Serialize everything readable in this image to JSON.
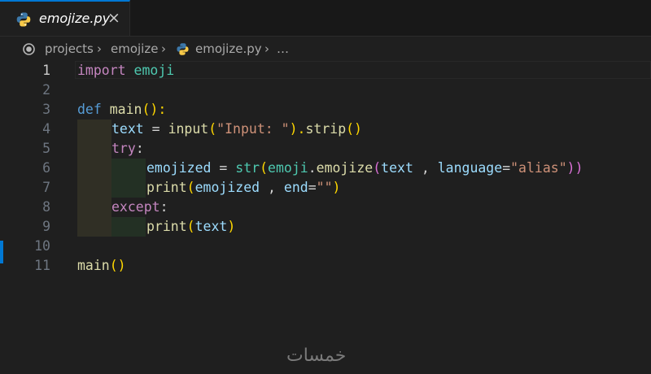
{
  "tab": {
    "filename": "emojize.py",
    "close_glyph": "×"
  },
  "breadcrumb": {
    "items": [
      "projects",
      "emojize",
      "emojize.py",
      "…"
    ],
    "separator": "›"
  },
  "editor": {
    "language": "python",
    "active_line": 1,
    "line_numbers": [
      "1",
      "2",
      "3",
      "4",
      "5",
      "6",
      "7",
      "8",
      "9",
      "10",
      "11"
    ],
    "tokens": {
      "l1": [
        "import",
        " ",
        "emoji"
      ],
      "l3": [
        "def",
        " ",
        "main",
        "():"
      ],
      "l4": [
        "text",
        " = ",
        "input",
        "(",
        "\"Input: \"",
        ").",
        "strip",
        "()"
      ],
      "l5": [
        "try",
        ":"
      ],
      "l6": [
        "emojized",
        " = ",
        "str",
        "(",
        "emoji",
        ".",
        "emojize",
        "(",
        "text",
        " , ",
        "language",
        "=",
        "\"alias\"",
        "))"
      ],
      "l7": [
        "print",
        "(",
        "emojized",
        " , ",
        "end",
        "=",
        "\"\"",
        ")"
      ],
      "l8": [
        "except",
        ":"
      ],
      "l9": [
        "print",
        "(",
        "text",
        ")"
      ],
      "l11": [
        "main",
        "()"
      ]
    }
  },
  "watermark": "خمسات",
  "colors": {
    "accent": "#0078d4",
    "keyword": "#569cd6",
    "control": "#c586c0",
    "function": "#dcdcaa",
    "module": "#4ec9b0",
    "variable": "#9cdcfe",
    "string": "#ce9178",
    "bracket1": "#ffd700",
    "bracket2": "#da70d6"
  },
  "icons": {
    "tab_icon": "python-icon",
    "breadcrumb_root": "target-icon",
    "breadcrumb_file": "python-icon",
    "close": "close-icon"
  }
}
